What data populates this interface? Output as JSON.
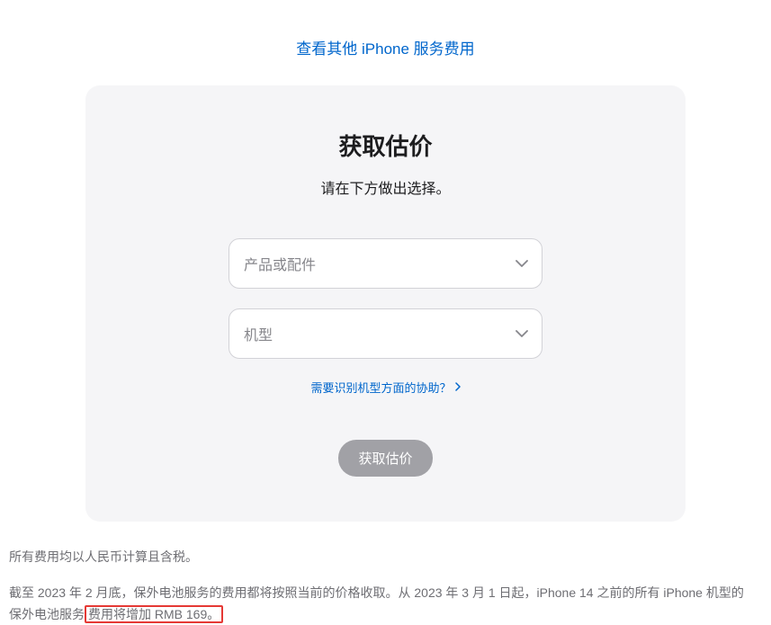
{
  "topLink": {
    "label": "查看其他 iPhone 服务费用"
  },
  "card": {
    "title": "获取估价",
    "subtitle": "请在下方做出选择。",
    "select1": {
      "placeholder": "产品或配件"
    },
    "select2": {
      "placeholder": "机型"
    },
    "helpLink": {
      "label": "需要识别机型方面的协助？"
    },
    "submitButton": {
      "label": "获取估价"
    }
  },
  "footer": {
    "para1": "所有费用均以人民币计算且含税。",
    "para2_part1": "截至 2023 年 2 月底，保外电池服务的费用都将按照当前的价格收取。从 2023 年 3 月 1 日起，iPhone 14 之前的所有 iPhone 机型的保外电池服务",
    "para2_highlight": "费用将增加 RMB 169。"
  }
}
